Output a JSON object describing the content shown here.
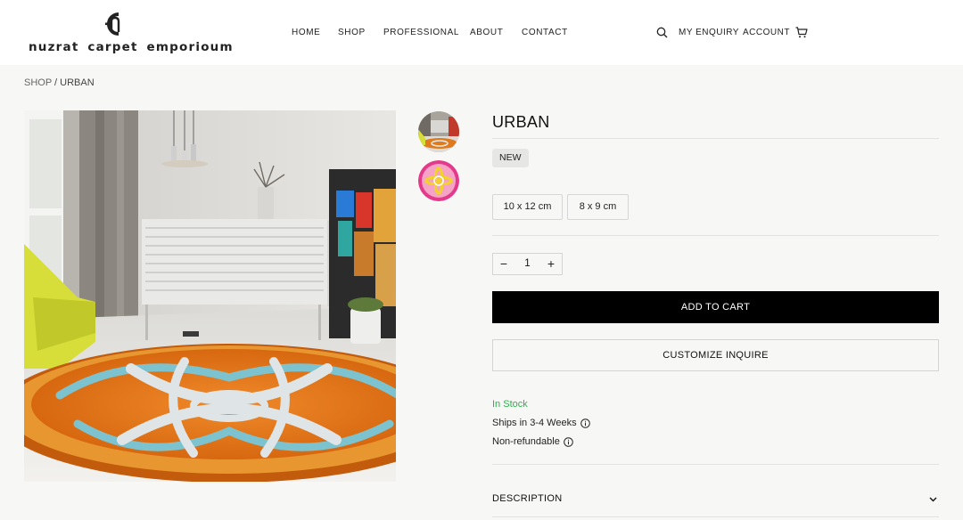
{
  "brand": {
    "logo_text": "nuzrat carpet emporioum"
  },
  "nav": {
    "home": "HOME",
    "shop": "SHOP",
    "professional": "PROFESSIONAL",
    "about": "ABOUT",
    "contact": "CONTACT",
    "my_enquiry": "MY ENQUIRY",
    "account": "ACCOUNT"
  },
  "icons": {
    "search": "search-icon",
    "cart": "cart-icon",
    "info": "info-icon",
    "chevron": "chevron-down-icon"
  },
  "breadcrumb": {
    "shop": "SHOP",
    "separator": "/",
    "current": "URBAN"
  },
  "product": {
    "title": "URBAN",
    "badge": "NEW",
    "sizes": [
      "10 x 12 cm",
      "8 x 9 cm"
    ],
    "quantity": "1",
    "qty_minus": "−",
    "qty_plus": "+",
    "add_to_cart": "ADD TO CART",
    "customize": "CUSTOMIZE INQUIRE",
    "stock_status": "In Stock",
    "ships": "Ships in 3-4 Weeks",
    "refund": "Non-refundable",
    "description_label": "DESCRIPTION"
  },
  "colors": {
    "accent": "#000000",
    "stock_green": "#2bb24c",
    "rug_orange": "#e8751a",
    "rug_blue": "#7cc3cf",
    "page_bg": "#f7f7f5"
  }
}
